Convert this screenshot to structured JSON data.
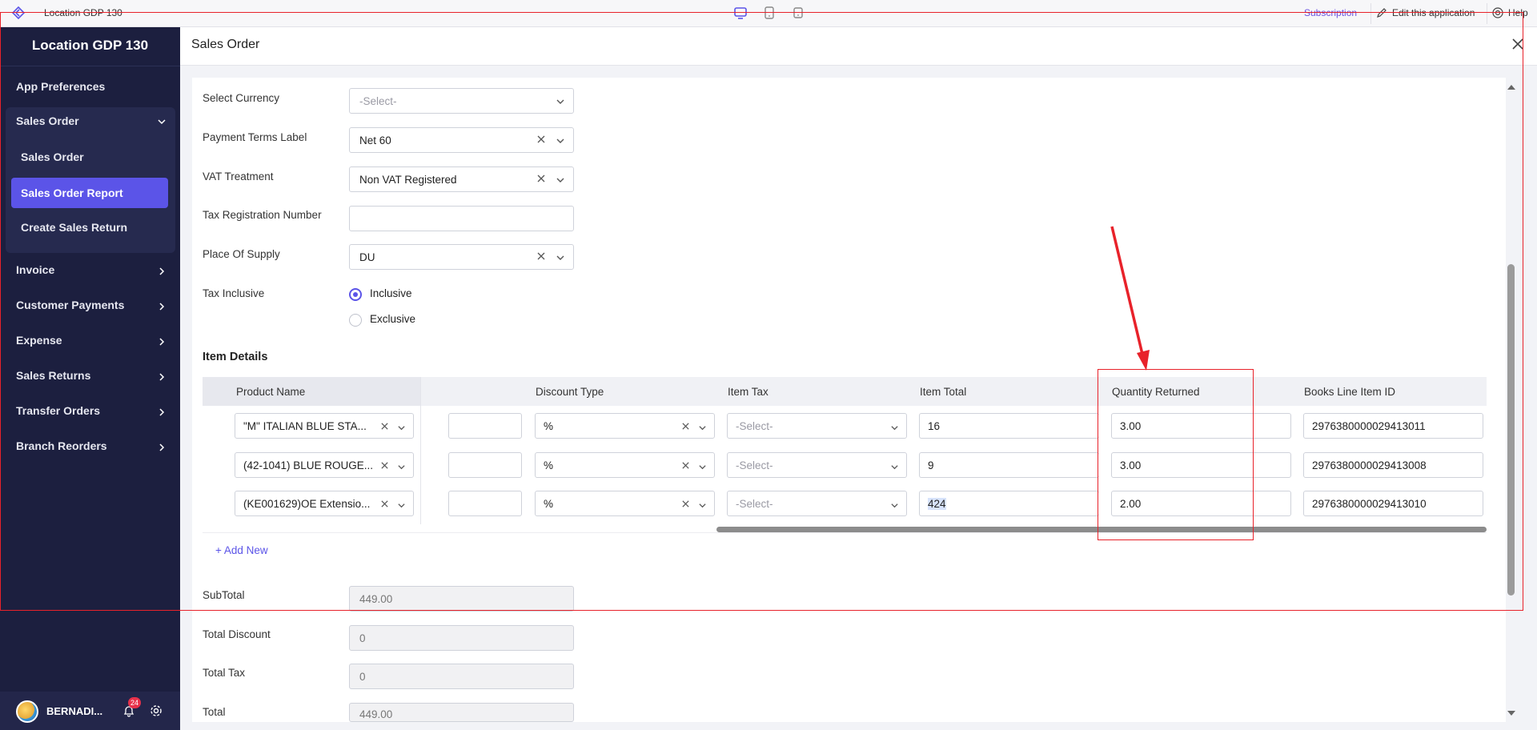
{
  "topbar": {
    "app_title": "Location GDP 130",
    "subscription": "Subscription",
    "edit_app": "Edit this application",
    "help": "Help"
  },
  "sidebar": {
    "brand": "Location GDP 130",
    "items": [
      {
        "label": "App Preferences"
      },
      {
        "label": "Sales Order",
        "expanded": true
      },
      {
        "label": "Invoice"
      },
      {
        "label": "Customer Payments"
      },
      {
        "label": "Expense"
      },
      {
        "label": "Sales Returns"
      },
      {
        "label": "Transfer Orders"
      },
      {
        "label": "Branch Reorders"
      }
    ],
    "sub_items": [
      {
        "label": "Sales Order"
      },
      {
        "label": "Sales Order Report",
        "active": true
      },
      {
        "label": "Create Sales Return"
      }
    ],
    "user": {
      "name": "BERNADI...",
      "notifications": "24"
    }
  },
  "header": {
    "title": "Sales Order"
  },
  "form": {
    "select_currency": {
      "label": "Select Currency",
      "placeholder": "-Select-"
    },
    "payment_terms": {
      "label": "Payment Terms Label",
      "value": "Net 60"
    },
    "vat_treatment": {
      "label": "VAT Treatment",
      "value": "Non VAT Registered"
    },
    "tax_reg": {
      "label": "Tax Registration Number",
      "value": ""
    },
    "place_of_supply": {
      "label": "Place Of Supply",
      "value": "DU"
    },
    "tax_inclusive": {
      "label": "Tax Inclusive",
      "options": [
        "Inclusive",
        "Exclusive"
      ],
      "selected": "Inclusive"
    }
  },
  "items": {
    "title": "Item Details",
    "columns": [
      "Product Name",
      "Discount Type",
      "Item Tax",
      "Item Total",
      "Quantity Returned",
      "Books Line Item ID"
    ],
    "rows": [
      {
        "product": "\"M\" ITALIAN BLUE STA...",
        "discount_type": "%",
        "item_tax": "-Select-",
        "item_total": "16",
        "qty_returned": "3.00",
        "line_id": "2976380000029413011"
      },
      {
        "product": "(42-1041) BLUE ROUGE...",
        "discount_type": "%",
        "item_tax": "-Select-",
        "item_total": "9",
        "qty_returned": "3.00",
        "line_id": "2976380000029413008"
      },
      {
        "product": "(KE001629)OE Extensio...",
        "discount_type": "%",
        "item_tax": "-Select-",
        "item_total": "424",
        "qty_returned": "2.00",
        "line_id": "2976380000029413010"
      }
    ],
    "add_new": "Add New"
  },
  "totals": {
    "subtotal": {
      "label": "SubTotal",
      "value": "449.00"
    },
    "total_discount": {
      "label": "Total Discount",
      "value": "0"
    },
    "total_tax": {
      "label": "Total Tax",
      "value": "0"
    },
    "total": {
      "label": "Total",
      "value": "449.00"
    }
  },
  "colors": {
    "accent": "#5b54e8",
    "sidebar": "#1c1f3f",
    "annotation": "#e8222a"
  }
}
